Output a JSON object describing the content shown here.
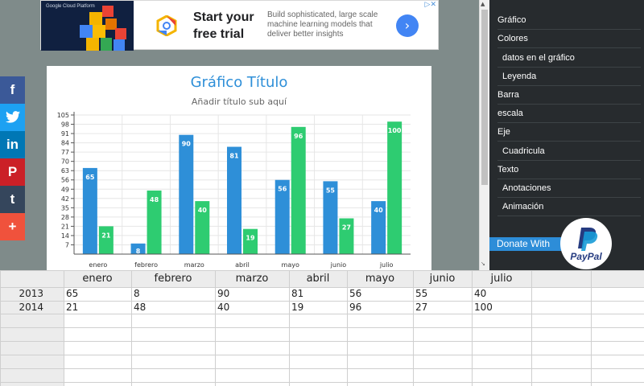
{
  "ad": {
    "art_text": "Google Cloud Platform",
    "headline": "Start your free trial",
    "description": "Build sophisticated, large scale machine learning models that deliver better insights",
    "cta_icon": "chevron-right-icon",
    "close_icon": "adchoices-close-icon"
  },
  "social": {
    "facebook": "f",
    "twitter": "t-bird",
    "linkedin": "in",
    "pinterest": "P",
    "tumblr": "t",
    "more": "+"
  },
  "menu": {
    "items": [
      {
        "label": "Gráfico",
        "sub": false
      },
      {
        "label": "Colores",
        "sub": false
      },
      {
        "label": "datos en el gráfico",
        "sub": true
      },
      {
        "label": "Leyenda",
        "sub": true
      },
      {
        "label": "Barra",
        "sub": false
      },
      {
        "label": "escala",
        "sub": false
      },
      {
        "label": "Eje",
        "sub": false
      },
      {
        "label": "Cuadricula",
        "sub": true
      },
      {
        "label": "Texto",
        "sub": false
      },
      {
        "label": "Anotaciones",
        "sub": true
      },
      {
        "label": "Animación",
        "sub": true
      }
    ],
    "donate_label": "Donate With",
    "paypal_label": "PayPal"
  },
  "chart_data": {
    "type": "bar",
    "title": "Gráfico Título",
    "subtitle": "Añadir título sub aquí",
    "categories": [
      "enero",
      "febrero",
      "marzo",
      "abril",
      "mayo",
      "junio",
      "julio"
    ],
    "series": [
      {
        "values": [
          65,
          8,
          90,
          81,
          56,
          55,
          40
        ],
        "color": "#2e8fd8"
      },
      {
        "values": [
          21,
          48,
          40,
          19,
          96,
          27,
          100
        ],
        "color": "#2ecc71"
      }
    ],
    "ylim": [
      0,
      105
    ],
    "yticks": [
      7,
      14,
      21,
      28,
      35,
      42,
      49,
      56,
      63,
      70,
      77,
      84,
      91,
      98,
      105
    ],
    "ytick_labels": [
      "7",
      "14",
      "21",
      "28",
      "35",
      "42",
      "49",
      "56",
      "63",
      "70",
      "77",
      "84",
      "91",
      "98",
      "105"
    ],
    "grid": true,
    "data_labels": true
  },
  "sheet": {
    "headers": [
      "",
      "enero",
      "febrero",
      "marzo",
      "abril",
      "mayo",
      "junio",
      "julio",
      "",
      ""
    ],
    "rows": [
      [
        "2013",
        "65",
        "8",
        "90",
        "81",
        "56",
        "55",
        "40",
        "",
        ""
      ],
      [
        "2014",
        "21",
        "48",
        "40",
        "19",
        "96",
        "27",
        "100",
        "",
        ""
      ],
      [
        "",
        "",
        "",
        "",
        "",
        "",
        "",
        "",
        "",
        ""
      ],
      [
        "",
        "",
        "",
        "",
        "",
        "",
        "",
        "",
        "",
        ""
      ],
      [
        "",
        "",
        "",
        "",
        "",
        "",
        "",
        "",
        "",
        ""
      ],
      [
        "",
        "",
        "",
        "",
        "",
        "",
        "",
        "",
        "",
        ""
      ],
      [
        "",
        "",
        "",
        "",
        "",
        "",
        "",
        "",
        "",
        ""
      ]
    ]
  },
  "colors": {
    "accent": "#2e8fd8",
    "series2": "#2ecc71",
    "menu_bg": "#272b2e",
    "page_bg": "#7f8b8a"
  }
}
